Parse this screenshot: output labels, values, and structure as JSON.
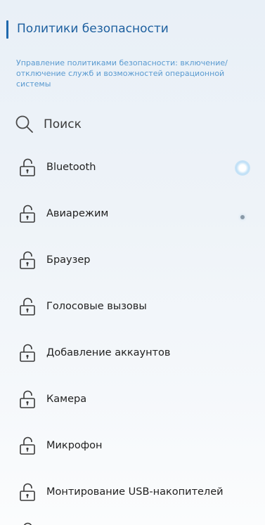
{
  "header": {
    "title": "Политики безопасности"
  },
  "description": "Управление политиками безопасности: включение/отключение служб и возможностей операционной системы",
  "search": {
    "label": "Поиск",
    "icon": "search-icon"
  },
  "policies": [
    {
      "label": "Bluetooth",
      "icon": "lock-open-icon"
    },
    {
      "label": "Авиарежим",
      "icon": "lock-open-icon"
    },
    {
      "label": "Браузер",
      "icon": "lock-open-icon"
    },
    {
      "label": "Голосовые вызовы",
      "icon": "lock-open-icon"
    },
    {
      "label": "Добавление аккаунтов",
      "icon": "lock-open-icon"
    },
    {
      "label": "Камера",
      "icon": "lock-open-icon"
    },
    {
      "label": "Микрофон",
      "icon": "lock-open-icon"
    },
    {
      "label": "Монтирование USB-накопителей",
      "icon": "lock-open-icon"
    }
  ],
  "colors": {
    "accent": "#1e68ad",
    "title": "#1d5f9f",
    "description": "#5a9ad0",
    "text": "#1f1f1f"
  }
}
